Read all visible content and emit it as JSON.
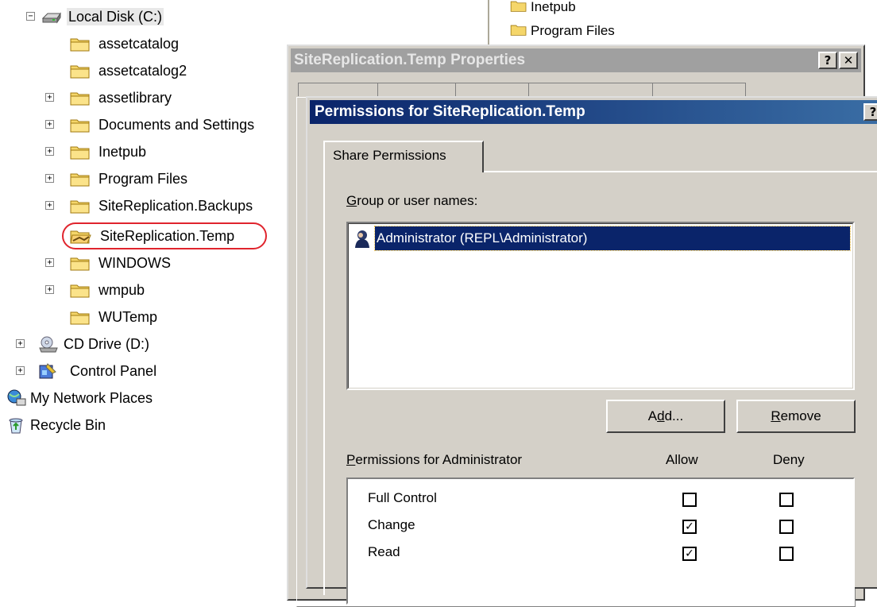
{
  "tree": {
    "nodes": [
      {
        "label": "Local Disk (C:)",
        "icon": "hard-drive-icon",
        "expander": "−"
      },
      {
        "label": "assetcatalog",
        "icon": "folder-icon",
        "expander": ""
      },
      {
        "label": "assetcatalog2",
        "icon": "folder-icon",
        "expander": ""
      },
      {
        "label": "assetlibrary",
        "icon": "folder-icon",
        "expander": "+"
      },
      {
        "label": "Documents and Settings",
        "icon": "folder-icon",
        "expander": "+"
      },
      {
        "label": "Inetpub",
        "icon": "folder-icon",
        "expander": "+"
      },
      {
        "label": "Program Files",
        "icon": "folder-icon",
        "expander": "+"
      },
      {
        "label": "SiteReplication.Backups",
        "icon": "folder-icon",
        "expander": "+"
      },
      {
        "label": "SiteReplication.Temp",
        "icon": "shared-folder-icon",
        "expander": ""
      },
      {
        "label": "WINDOWS",
        "icon": "folder-icon",
        "expander": "+"
      },
      {
        "label": "wmpub",
        "icon": "folder-icon",
        "expander": "+"
      },
      {
        "label": "WUTemp",
        "icon": "folder-icon",
        "expander": ""
      },
      {
        "label": "CD Drive (D:)",
        "icon": "cd-drive-icon",
        "expander": "+"
      },
      {
        "label": "Control Panel",
        "icon": "control-panel-icon",
        "expander": "+"
      },
      {
        "label": "My Network Places",
        "icon": "network-places-icon",
        "expander": ""
      },
      {
        "label": "Recycle Bin",
        "icon": "recycle-bin-icon",
        "expander": ""
      }
    ]
  },
  "background_window": {
    "items": [
      "Inetpub",
      "Program Files"
    ]
  },
  "properties_dialog": {
    "title": "SiteReplication.Temp Properties",
    "help_glyph": "?",
    "close_glyph": "✕"
  },
  "permissions_dialog": {
    "title": "Permissions for SiteReplication.Temp",
    "help_glyph": "?",
    "close_glyph": "✕",
    "tab_label": "Share Permissions",
    "group_label_accel": "G",
    "group_label_rest": "roup or user names:",
    "users": [
      {
        "name": "Administrator (REPL\\Administrator)",
        "icon": "user-icon",
        "selected": true
      }
    ],
    "add_button_pre": "A",
    "add_button_accel": "d",
    "add_button_post": "d...",
    "remove_button_accel": "R",
    "remove_button_rest": "emove",
    "perms_label_accel": "P",
    "perms_label_rest": "ermissions for Administrator",
    "allow_header": "Allow",
    "deny_header": "Deny",
    "permissions": [
      {
        "name": "Full Control",
        "allow": false,
        "deny": false
      },
      {
        "name": "Change",
        "allow": true,
        "deny": false
      },
      {
        "name": "Read",
        "allow": true,
        "deny": false
      }
    ]
  },
  "colors": {
    "active_title": "#0a246a",
    "inactive_title": "#a0a0a0",
    "dialog_face": "#d4d0c8",
    "highlight_ring": "#e0242d"
  }
}
